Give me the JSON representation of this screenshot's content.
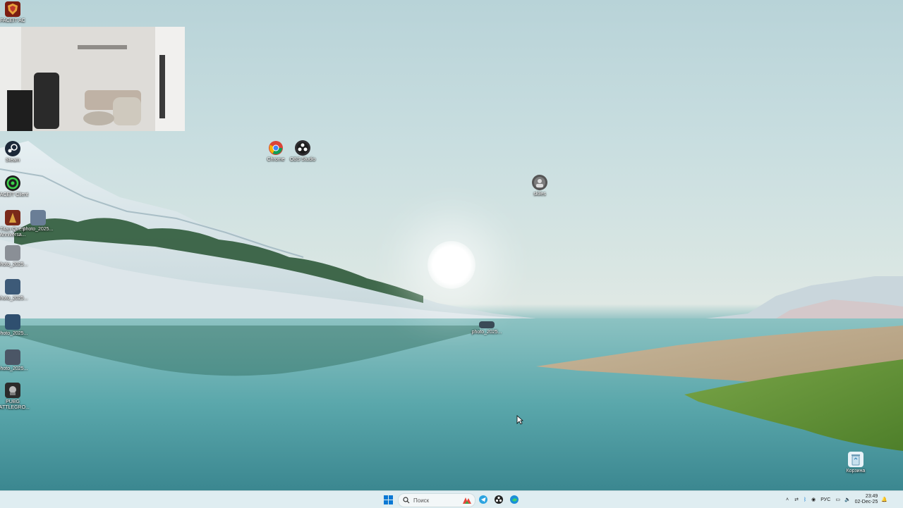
{
  "desktop": {
    "icons": [
      {
        "label": "FACEIT AC",
        "icon": "faceit-anticheat-icon",
        "color": "#c0392b"
      },
      {
        "label": "Steam",
        "icon": "steam-icon",
        "color": "#1b2838"
      },
      {
        "label": "FACEIT Client",
        "icon": "faceit-client-icon",
        "color": "#1f1f1f"
      },
      {
        "label": "Titan Quest Anniversa...",
        "icon": "titan-quest-icon",
        "color": "#7a2a1a"
      },
      {
        "label": "photo_2025...",
        "icon": "photo-thumbnail-icon",
        "color": "#6a7e96"
      },
      {
        "label": "photo_2025...",
        "icon": "photo-thumbnail-icon",
        "color": "#8a8f96"
      },
      {
        "label": "photo_2025...",
        "icon": "photo-thumbnail-icon",
        "color": "#3d5a78"
      },
      {
        "label": "photo_2025...",
        "icon": "photo-thumbnail-icon",
        "color": "#2f4f6f"
      },
      {
        "label": "photo_2025...",
        "icon": "photo-thumbnail-icon",
        "color": "#4b5666"
      },
      {
        "label": "PUBG BATTLEGRO...",
        "icon": "pubg-icon",
        "color": "#2b2b2b"
      },
      {
        "label": "Chrome",
        "icon": "chrome-icon",
        "color": "#4285f4"
      },
      {
        "label": "OBS Studio",
        "icon": "obs-studio-icon",
        "color": "#302e31"
      },
      {
        "label": "skiles",
        "icon": "avatar-shortcut-icon",
        "color": "#555555"
      },
      {
        "label": "photo_2025...",
        "icon": "photo-thumbnail-icon",
        "color": "#3a4a57"
      },
      {
        "label": "Корзина",
        "icon": "recycle-bin-icon",
        "color": "#e8f2f8"
      }
    ]
  },
  "taskbar": {
    "search_placeholder": "Поиск",
    "pinned": [
      {
        "name": "start-button",
        "icon": "windows-start-icon"
      },
      {
        "name": "widget-app",
        "icon": "colorful-app-icon"
      },
      {
        "name": "telegram",
        "icon": "telegram-icon"
      },
      {
        "name": "obs",
        "icon": "obs-studio-icon"
      },
      {
        "name": "edge",
        "icon": "edge-icon"
      }
    ],
    "tray": {
      "language": "РУС",
      "time": "23:49",
      "date": "02-Dec-25"
    }
  },
  "colors": {
    "taskbar_bg": "#dcecf0",
    "accent": "#0078d4"
  }
}
